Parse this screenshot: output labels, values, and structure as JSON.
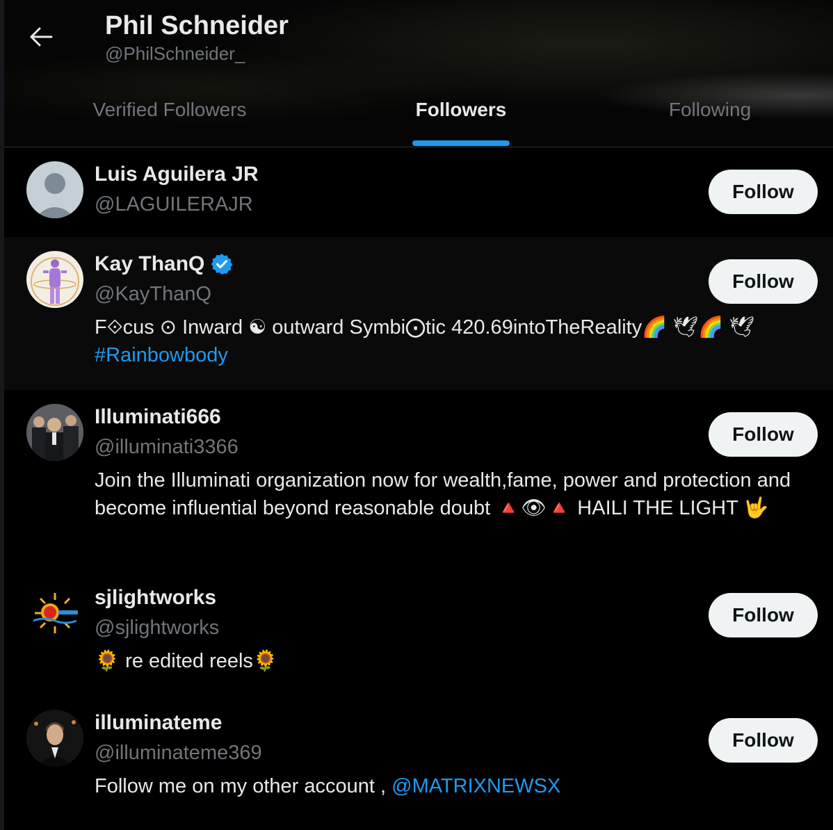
{
  "header": {
    "name": "Phil Schneider",
    "handle": "@PhilSchneider_"
  },
  "tabs": [
    {
      "label": "Verified Followers",
      "active": false
    },
    {
      "label": "Followers",
      "active": true
    },
    {
      "label": "Following",
      "active": false
    }
  ],
  "accent_color": "#1d9bf0",
  "follow_label": "Follow",
  "users": [
    {
      "name": "Luis Aguilera JR",
      "handle": "@LAGUILERAJR",
      "verified": false,
      "avatar": "default-avatar-icon"
    },
    {
      "name": "Kay ThanQ",
      "handle": "@KayThanQ",
      "verified": true,
      "avatar": "chakra-figure-avatar",
      "bio_text": "F⟐cus ⊙ Inward ☯ outward Symbi⨀tic 420.69intoTheReality🌈 🕊🌈 🕊",
      "bio_link": "#Rainbowbody"
    },
    {
      "name": "Illuminati666",
      "handle": "@illuminati3366",
      "verified": false,
      "avatar": "suit-men-photo-avatar",
      "bio_text": "Join the Illuminati organization now for wealth,fame, power and protection and become influential beyond reasonable doubt 🔺👁🔺 HAILI THE LIGHT 🤟"
    },
    {
      "name": "sjlightworks",
      "handle": "@sjlightworks",
      "verified": false,
      "avatar": "sj-sun-logo-avatar",
      "bio_text": "🌻 re edited reels🌻"
    },
    {
      "name": "illuminateme",
      "handle": "@illuminateme369",
      "verified": false,
      "avatar": "man-portrait-avatar",
      "bio_text": "Follow me on my other account , ",
      "bio_link": "@MATRIXNEWSX"
    }
  ]
}
